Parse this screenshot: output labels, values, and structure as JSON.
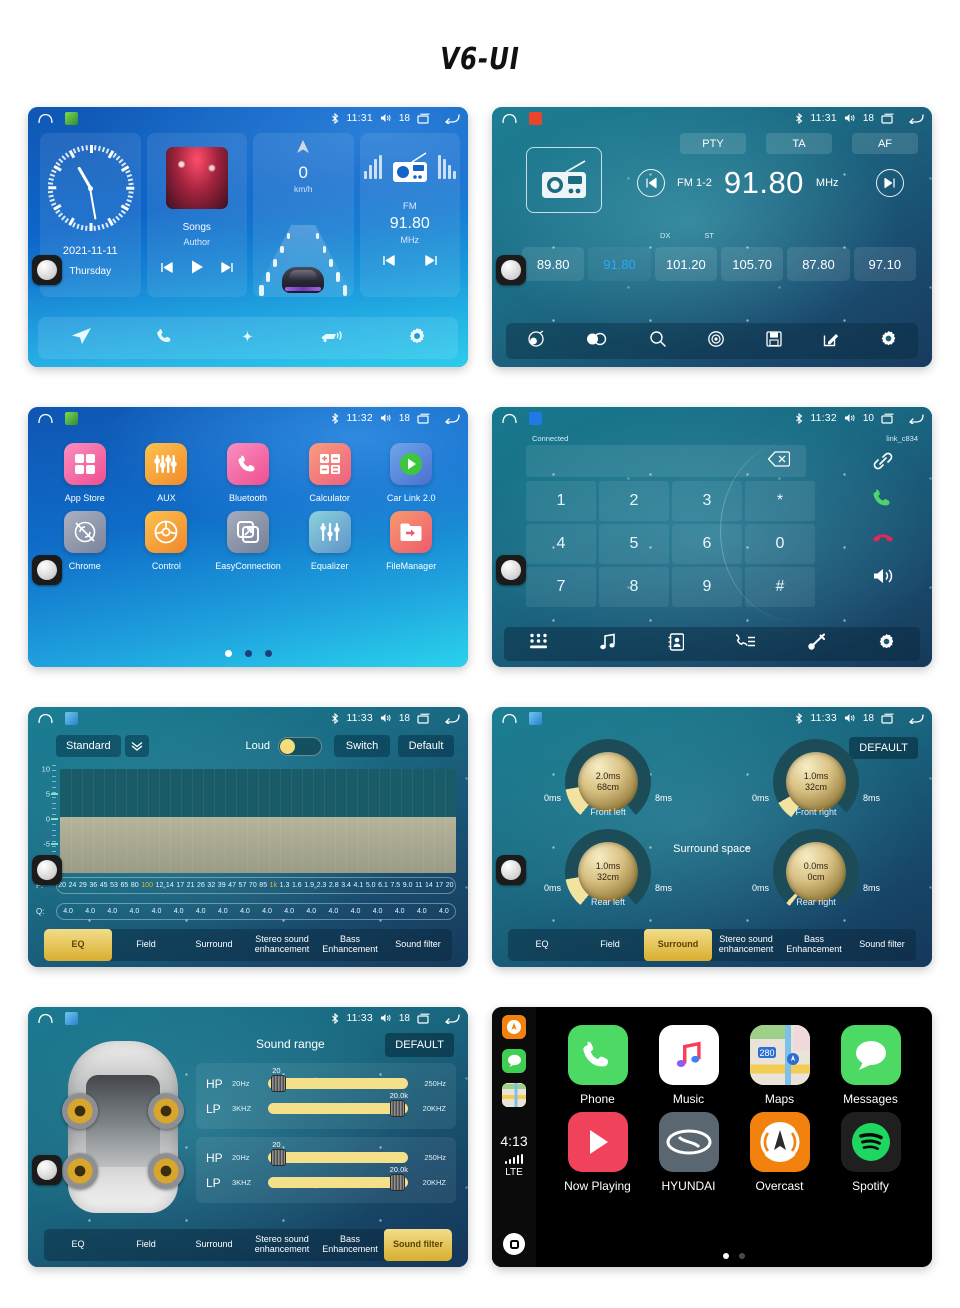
{
  "page": {
    "title": "V6-UI"
  },
  "status_bars": {
    "home": {
      "time": "11:31",
      "volume": "18",
      "bt": "bluetooth-icon"
    },
    "radio": {
      "time": "11:31",
      "volume": "18",
      "bt": "bluetooth-icon"
    },
    "apps": {
      "time": "11:32",
      "volume": "18",
      "bt": "bluetooth-icon"
    },
    "dialer": {
      "time": "11:32",
      "volume": "10",
      "bt": "bluetooth-icon"
    },
    "eq": {
      "time": "11:33",
      "volume": "18",
      "bt": "bluetooth-icon"
    },
    "surround": {
      "time": "11:33",
      "volume": "18",
      "bt": "bluetooth-icon"
    },
    "sfilter": {
      "time": "11:33",
      "volume": "18",
      "bt": "bluetooth-icon"
    }
  },
  "home": {
    "clock": {
      "date": "2021-11-11",
      "weekday": "Thursday"
    },
    "music": {
      "title": "Songs",
      "artist": "Author",
      "prev": "previous-track-icon",
      "play": "play-icon",
      "next": "next-track-icon"
    },
    "speed": {
      "value": "0",
      "unit": "km/h"
    },
    "radio": {
      "band": "FM",
      "frequency": "91.80",
      "unit": "MHz"
    },
    "dock": [
      "navigation-icon",
      "phone-icon",
      "apps-icon",
      "carlink-icon",
      "settings-icon"
    ]
  },
  "radio": {
    "rds_buttons": [
      "PTY",
      "TA",
      "AF"
    ],
    "band": "FM 1-2",
    "frequency": "91.80",
    "unit": "MHz",
    "dx": "DX",
    "st": "ST",
    "presets": [
      {
        "freq": "89.80",
        "active": false
      },
      {
        "freq": "91.80",
        "active": true
      },
      {
        "freq": "101.20",
        "active": false
      },
      {
        "freq": "105.70",
        "active": false
      },
      {
        "freq": "87.80",
        "active": false
      },
      {
        "freq": "97.10",
        "active": false
      }
    ],
    "dock": [
      "band-icon",
      "stereo-icon",
      "search-icon",
      "rds-icon",
      "save-icon",
      "edit-icon",
      "settings-icon"
    ]
  },
  "apps": {
    "items": [
      {
        "label": "App Store",
        "color": "#f25ba0"
      },
      {
        "label": "AUX",
        "color": "#f9a03a"
      },
      {
        "label": "Bluetooth",
        "color": "#f15f9a"
      },
      {
        "label": "Calculator",
        "color": "#f4775c"
      },
      {
        "label": "Car Link 2.0",
        "color": "#4f7fd6"
      },
      {
        "label": "Chrome",
        "color": "#8d93a6"
      },
      {
        "label": "Control",
        "color": "#f7a13a"
      },
      {
        "label": "EasyConnection",
        "color": "#8a93a8"
      },
      {
        "label": "Equalizer",
        "color": "#5fb8c9"
      },
      {
        "label": "FileManager",
        "color": "#f4695f"
      }
    ],
    "pages": 3,
    "current_page": 1
  },
  "dialer": {
    "connected_label": "Connected",
    "device_name": "link_c834",
    "input_value": "",
    "backspace": "backspace-icon",
    "keys": [
      "1",
      "2",
      "3",
      "*",
      "4",
      "5",
      "6",
      "0",
      "7",
      "8",
      "9",
      "#"
    ],
    "side_buttons": [
      "link-icon",
      "call-icon",
      "hangup-icon",
      "speaker-icon"
    ],
    "dock": [
      "keypad-icon",
      "music-icon",
      "contacts-icon",
      "call-log-icon",
      "bt-connect-icon",
      "settings-icon"
    ]
  },
  "eq": {
    "preset": "Standard",
    "chevron": "chevron-down-icon",
    "loud_label": "Loud",
    "loud_on": true,
    "switch_label": "Switch",
    "default_label": "Default",
    "y_axis": [
      "10",
      "5",
      "0",
      "-5"
    ],
    "freq_label": "F:",
    "q_label": "Q:",
    "frequencies": [
      "20",
      "24",
      "29",
      "36",
      "45",
      "53",
      "65",
      "80",
      "100",
      "12",
      "14",
      "17",
      "21",
      "26",
      "32",
      "39",
      "47",
      "57",
      "70",
      "85",
      "1k",
      "1.3",
      "1.6",
      "1.9",
      "2.3",
      "2.8",
      "3.4",
      "4.1",
      "5.0",
      "6.1",
      "7.5",
      "9.0",
      "11",
      "14",
      "17",
      "20"
    ],
    "highlighted_frequencies": [
      "100",
      "1k"
    ],
    "q_values": [
      "4.0",
      "4.0",
      "4.0",
      "4.0",
      "4.0",
      "4.0",
      "4.0",
      "4.0",
      "4.0",
      "4.0",
      "4.0",
      "4.0",
      "4.0",
      "4.0",
      "4.0",
      "4.0",
      "4.0",
      "4.0"
    ],
    "tabs": [
      {
        "label": "EQ",
        "active": true
      },
      {
        "label": "Field",
        "active": false
      },
      {
        "label": "Surround",
        "active": false
      },
      {
        "label": "Stereo sound enhancement",
        "active": false
      },
      {
        "label": "Bass Enhancement",
        "active": false
      },
      {
        "label": "Sound filter",
        "active": false
      }
    ]
  },
  "surround": {
    "default_label": "DEFAULT",
    "title": "Surround space",
    "knobs": [
      {
        "name": "Front left",
        "time": "2.0ms",
        "distance": "68cm",
        "min": "0ms",
        "max": "8ms"
      },
      {
        "name": "Front right",
        "time": "1.0ms",
        "distance": "32cm",
        "min": "0ms",
        "max": "8ms"
      },
      {
        "name": "Rear left",
        "time": "1.0ms",
        "distance": "32cm",
        "min": "0ms",
        "max": "8ms"
      },
      {
        "name": "Rear right",
        "time": "0.0ms",
        "distance": "0cm",
        "min": "0ms",
        "max": "8ms"
      }
    ],
    "tabs": [
      {
        "label": "EQ",
        "active": false
      },
      {
        "label": "Field",
        "active": false
      },
      {
        "label": "Surround",
        "active": true
      },
      {
        "label": "Stereo sound enhancement",
        "active": false
      },
      {
        "label": "Bass Enhancement",
        "active": false
      },
      {
        "label": "Sound filter",
        "active": false
      }
    ]
  },
  "sound_filter": {
    "title": "Sound range",
    "default_label": "DEFAULT",
    "groups": [
      {
        "rows": [
          {
            "tag": "HP",
            "low": "20Hz",
            "high": "250Hz",
            "value": "20",
            "pos": 4
          },
          {
            "tag": "LP",
            "low": "3KHZ",
            "high": "20KHZ",
            "value": "20.0k",
            "pos": 96
          }
        ]
      },
      {
        "rows": [
          {
            "tag": "HP",
            "low": "20Hz",
            "high": "250Hz",
            "value": "20",
            "pos": 4
          },
          {
            "tag": "LP",
            "low": "3KHZ",
            "high": "20KHZ",
            "value": "20.0k",
            "pos": 96
          }
        ]
      }
    ],
    "tabs": [
      {
        "label": "EQ",
        "active": false
      },
      {
        "label": "Field",
        "active": false
      },
      {
        "label": "Surround",
        "active": false
      },
      {
        "label": "Stereo sound enhancement",
        "active": false
      },
      {
        "label": "Bass Enhancement",
        "active": false
      },
      {
        "label": "Sound filter",
        "active": true
      }
    ]
  },
  "carplay": {
    "time": "4:13",
    "network": "LTE",
    "sidebar_icons": [
      "overcast-icon",
      "messages-icon",
      "maps-icon"
    ],
    "home_icon": "carplay-home-icon",
    "apps": [
      {
        "label": "Phone",
        "icon": "phone-icon"
      },
      {
        "label": "Music",
        "icon": "music-icon"
      },
      {
        "label": "Maps",
        "icon": "maps-icon"
      },
      {
        "label": "Messages",
        "icon": "messages-icon"
      },
      {
        "label": "Now Playing",
        "icon": "now-playing-icon"
      },
      {
        "label": "HYUNDAI",
        "icon": "hyundai-icon"
      },
      {
        "label": "Overcast",
        "icon": "overcast-icon"
      },
      {
        "label": "Spotify",
        "icon": "spotify-icon"
      }
    ],
    "pages": 2,
    "current_page": 1
  }
}
